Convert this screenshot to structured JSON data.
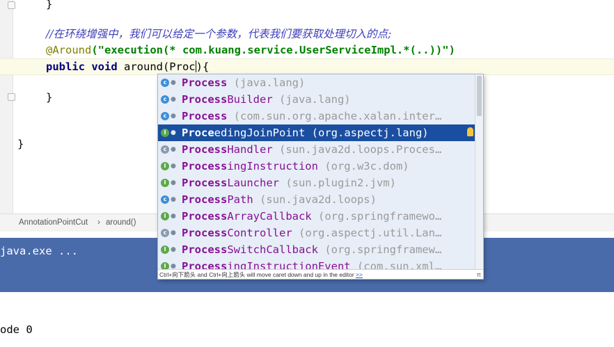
{
  "editor": {
    "lines": {
      "brace1": "}",
      "comment": "//在环绕增强中，我们可以给定一个参数，代表我们要获取处理切入的点;",
      "annotation": "@Around",
      "annotation_args": "(\"execution(* com.kuang.service.UserServiceImpl.*(..))\")",
      "method_kw": "public void",
      "method_rest": " around(Proc",
      "method_tail": "){",
      "brace2": "}",
      "brace3": "}"
    }
  },
  "breadcrumb": {
    "items": [
      "AnnotationPointCut",
      "around()"
    ],
    "separator": "›"
  },
  "completion": {
    "items": [
      {
        "kind": "c",
        "prefix": "Process",
        "rest": "",
        "pkg": " (java.lang)"
      },
      {
        "kind": "c",
        "prefix": "Process",
        "rest": "Builder",
        "pkg": " (java.lang)"
      },
      {
        "kind": "c",
        "prefix": "Process",
        "rest": "",
        "pkg": " (com.sun.org.apache.xalan.inter…"
      },
      {
        "kind": "i",
        "prefix": "Proce",
        "rest": "edingJoinPoint",
        "pkg": " (org.aspectj.lang)",
        "selected": true
      },
      {
        "kind": "ab",
        "prefix": "Process",
        "rest": "Handler",
        "pkg": " (sun.java2d.loops.Proces…"
      },
      {
        "kind": "i",
        "prefix": "Process",
        "rest": "ingInstruction",
        "pkg": " (org.w3c.dom)"
      },
      {
        "kind": "i",
        "prefix": "Process",
        "rest": "Launcher",
        "pkg": " (sun.plugin2.jvm)"
      },
      {
        "kind": "c",
        "prefix": "Process",
        "rest": "Path",
        "pkg": " (sun.java2d.loops)"
      },
      {
        "kind": "i",
        "prefix": "Process",
        "rest": "ArrayCallback",
        "pkg": " (org.springframewo…"
      },
      {
        "kind": "ab",
        "prefix": "Process",
        "rest": "Controller",
        "pkg": " (org.aspectj.util.Lan…"
      },
      {
        "kind": "i",
        "prefix": "Process",
        "rest": "SwitchCallback",
        "pkg": " (org.springframew…"
      },
      {
        "kind": "i",
        "prefix": "Process",
        "rest": "ingInstructionEvent",
        "pkg": " (com.sun.xml…"
      }
    ],
    "footer_text": "Ctrl+向下箭头 and Ctrl+向上箭头 will move caret down and up in the editor ",
    "footer_link": ">>",
    "footer_pi": "π"
  },
  "run": {
    "title": "java.exe ..."
  },
  "console": {
    "line": "ode 0"
  },
  "colors": {
    "selection": "#1a4ea0",
    "popup_bg": "#e7eef7",
    "run_panel": "#4a6baa",
    "comment": "#3d3dbb",
    "annotation": "#808000",
    "string": "#008000",
    "keyword": "#000080",
    "class_name": "#871094"
  }
}
